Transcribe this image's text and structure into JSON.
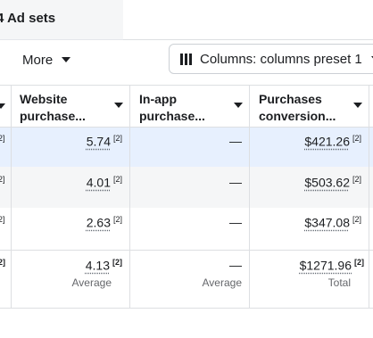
{
  "tab": {
    "label": "4 Ad sets"
  },
  "toolbar": {
    "more_label": "More",
    "columns_label": "Columns: columns preset 1"
  },
  "columns": [
    {
      "label_line1": "Website",
      "label_line2": "purchase..."
    },
    {
      "label_line1": "In-app",
      "label_line2": "purchase..."
    },
    {
      "label_line1": "Purchases",
      "label_line2": "conversion..."
    }
  ],
  "rows": [
    {
      "edge": "2]",
      "website": "5.74",
      "website_note": "[2]",
      "inapp": "—",
      "purchases": "$421.26",
      "purchases_note": "[2]"
    },
    {
      "edge": "2]",
      "website": "4.01",
      "website_note": "[2]",
      "inapp": "—",
      "purchases": "$503.62",
      "purchases_note": "[2]"
    },
    {
      "edge": "2]",
      "website": "2.63",
      "website_note": "[2]",
      "inapp": "—",
      "purchases": "$347.08",
      "purchases_note": "[2]"
    }
  ],
  "totals": {
    "edge": "2]",
    "website": "4.13",
    "website_note": "[2]",
    "website_label": "Average",
    "inapp": "—",
    "inapp_label": "Average",
    "purchases": "$1271.96",
    "purchases_note": "[2]",
    "purchases_label": "Total"
  }
}
